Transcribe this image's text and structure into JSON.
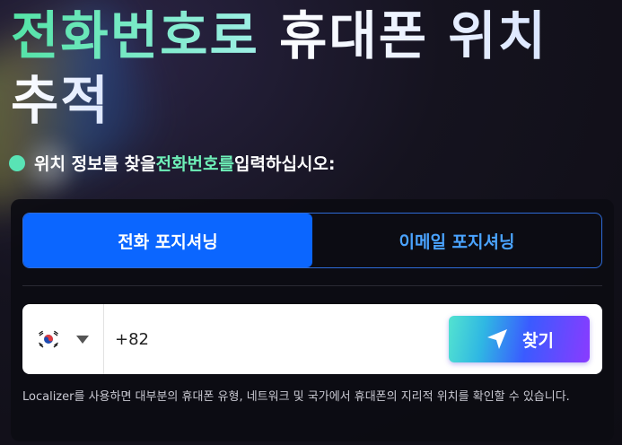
{
  "headline": {
    "highlight": "전화번호로",
    "line1_rest": " 휴대폰 위치",
    "line2": "추적"
  },
  "prompt": {
    "before": "위치 정보를 찾을 ",
    "highlight": "전화번호를",
    "after": " 입력하십시오:"
  },
  "tabs": [
    {
      "label": "전화 포지셔닝",
      "active": true
    },
    {
      "label": "이메일 포지셔닝",
      "active": false
    }
  ],
  "phone": {
    "country_flag": "kr-flag-icon",
    "value": "+82"
  },
  "find_button": {
    "label": "찾기",
    "icon": "navigation-arrow-icon"
  },
  "footnote": "Localizer를 사용하면 대부분의 휴대폰 유형, 네트워크 및 국가에서 휴대폰의 지리적 위치를 확인할 수 있습니다.",
  "colors": {
    "accent_green": "#53e3a6",
    "tab_active": "#0b66ff",
    "tab_inactive_text": "#4aa3ff",
    "button_gradient_start": "#53e3d0",
    "button_gradient_end": "#8a3bff"
  }
}
